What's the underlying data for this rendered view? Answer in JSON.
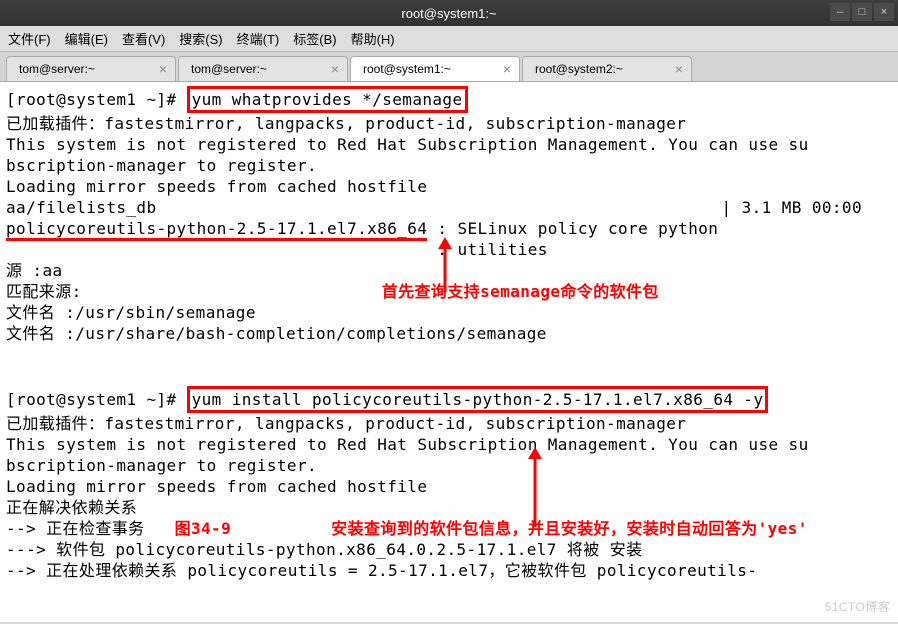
{
  "window": {
    "title": "root@system1:~"
  },
  "menubar": {
    "file": "文件(F)",
    "edit": "编辑(E)",
    "view": "查看(V)",
    "search": "搜索(S)",
    "terminal": "终端(T)",
    "tabs": "标签(B)",
    "help": "帮助(H)"
  },
  "tabs": [
    {
      "label": "tom@server:~",
      "active": false
    },
    {
      "label": "tom@server:~",
      "active": false
    },
    {
      "label": "root@system1:~",
      "active": true
    },
    {
      "label": "root@system2:~",
      "active": false
    }
  ],
  "terminal": {
    "prompt1": "[root@system1 ~]#",
    "cmd1": "yum whatprovides */semanage",
    "l1": "已加载插件：fastestmirror, langpacks, product-id, subscription-manager",
    "l2": "This system is not registered to Red Hat Subscription Management. You can use su",
    "l3": "bscription-manager to register.",
    "l4": "Loading mirror speeds from cached hostfile",
    "l5a": "aa/filelists_db",
    "l5b": "| 3.1 MB    00:00",
    "l6a": "policycoreutils-python-2.5-17.1.el7.x86_64",
    "l6b": " : SELinux policy core python",
    "l7": "                                           : utilities",
    "l8": "源       :aa",
    "l9": "匹配来源:",
    "l10": "文件名    :/usr/sbin/semanage",
    "l11": "文件名    :/usr/share/bash-completion/completions/semanage",
    "note1": "首先查询支持semanage命令的软件包",
    "prompt2": "[root@system1 ~]#",
    "cmd2": "yum install policycoreutils-python-2.5-17.1.el7.x86_64 -y",
    "l12": "已加载插件：fastestmirror, langpacks, product-id, subscription-manager",
    "l13": "This system is not registered to Red Hat Subscription Management. You can use su",
    "l14": "bscription-manager to register.",
    "l15": "Loading mirror speeds from cached hostfile",
    "l16": "正在解决依赖关系",
    "l17": "--> 正在检查事务",
    "fig_label": "图34-9",
    "note2": "安装查询到的软件包信息，并且安装好，安装时自动回答为'yes'",
    "l18": "---> 软件包 policycoreutils-python.x86_64.0.2.5-17.1.el7 将被 安装",
    "l19": "--> 正在处理依赖关系 policycoreutils = 2.5-17.1.el7，它被软件包 policycoreutils-"
  },
  "watermark": "51CTO博客"
}
